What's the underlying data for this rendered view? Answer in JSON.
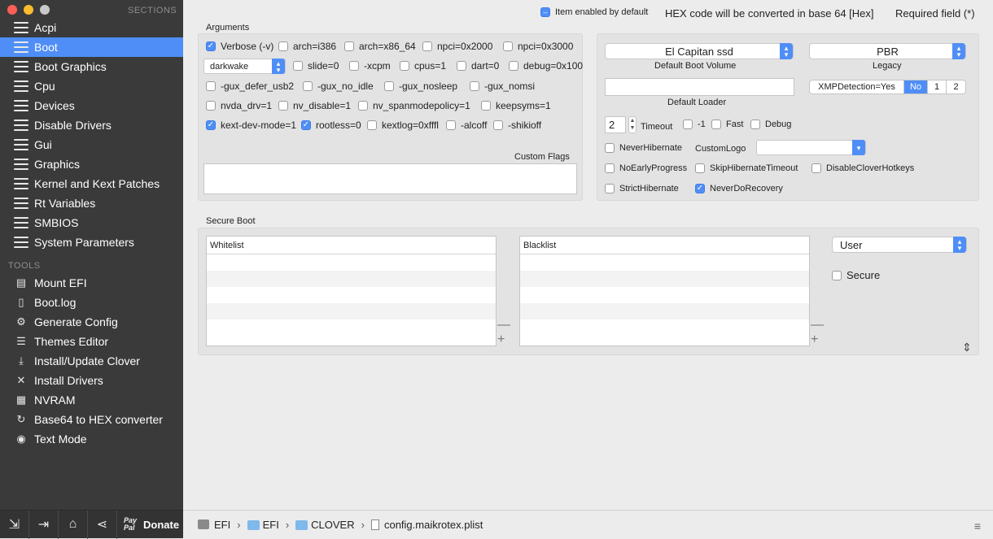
{
  "sidebar": {
    "sections_header": "SECTIONS",
    "tools_header": "TOOLS",
    "sections": [
      {
        "label": "Acpi"
      },
      {
        "label": "Boot"
      },
      {
        "label": "Boot Graphics"
      },
      {
        "label": "Cpu"
      },
      {
        "label": "Devices"
      },
      {
        "label": "Disable Drivers"
      },
      {
        "label": "Gui"
      },
      {
        "label": "Graphics"
      },
      {
        "label": "Kernel and Kext Patches"
      },
      {
        "label": "Rt Variables"
      },
      {
        "label": "SMBIOS"
      },
      {
        "label": "System Parameters"
      }
    ],
    "selected_section": "Boot",
    "tools": [
      {
        "label": "Mount EFI",
        "icon": "disk-icon"
      },
      {
        "label": "Boot.log",
        "icon": "document-icon"
      },
      {
        "label": "Generate Config",
        "icon": "gears-icon"
      },
      {
        "label": "Themes Editor",
        "icon": "hamburger-icon"
      },
      {
        "label": "Install/Update Clover",
        "icon": "download-icon"
      },
      {
        "label": "Install Drivers",
        "icon": "wrench-icon"
      },
      {
        "label": "NVRAM",
        "icon": "chip-icon"
      },
      {
        "label": "Base64 to HEX converter",
        "icon": "refresh-icon"
      },
      {
        "label": "Text Mode",
        "icon": "eye-icon"
      }
    ],
    "bottom": {
      "donate_label": "Donate",
      "paypal_text": "Pay Pal"
    }
  },
  "legend": {
    "item_enabled": "Item enabled by default",
    "hex_note": "HEX code will be converted in base 64 [Hex]",
    "required": "Required field (*)"
  },
  "arguments": {
    "title": "Arguments",
    "rows": [
      [
        {
          "label": "Verbose (-v)",
          "checked": true
        },
        {
          "label": "arch=i386",
          "checked": false
        },
        {
          "label": "arch=x86_64",
          "checked": false
        },
        {
          "label": "npci=0x2000",
          "checked": false
        },
        {
          "label": "npci=0x3000",
          "checked": false
        }
      ],
      [
        {
          "label": "slide=0",
          "checked": false
        },
        {
          "label": "-xcpm",
          "checked": false
        },
        {
          "label": "cpus=1",
          "checked": false
        },
        {
          "label": "dart=0",
          "checked": false
        },
        {
          "label": "debug=0x100",
          "checked": false
        }
      ],
      [
        {
          "label": "-gux_defer_usb2",
          "checked": false
        },
        {
          "label": "-gux_no_idle",
          "checked": false
        },
        {
          "label": "-gux_nosleep",
          "checked": false
        },
        {
          "label": "-gux_nomsi",
          "checked": false
        }
      ],
      [
        {
          "label": "nvda_drv=1",
          "checked": false
        },
        {
          "label": "nv_disable=1",
          "checked": false
        },
        {
          "label": "nv_spanmodepolicy=1",
          "checked": false
        },
        {
          "label": "keepsyms=1",
          "checked": false
        }
      ],
      [
        {
          "label": "kext-dev-mode=1",
          "checked": true
        },
        {
          "label": "rootless=0",
          "checked": true
        },
        {
          "label": "kextlog=0xfffl",
          "checked": false
        },
        {
          "label": "-alcoff",
          "checked": false
        },
        {
          "label": "-shikioff",
          "checked": false
        }
      ]
    ],
    "darkwake_value": "darkwake",
    "custom_flags_label": "Custom Flags",
    "custom_flags_value": ""
  },
  "boot_options": {
    "default_volume_value": "El Capitan ssd",
    "default_volume_label": "Default Boot Volume",
    "legacy_value": "PBR",
    "legacy_label": "Legacy",
    "default_loader_label": "Default Loader",
    "default_loader_value": "",
    "xmp_label": "XMPDetection=Yes",
    "xmp_options": [
      "No",
      "1",
      "2"
    ],
    "xmp_selected": "No",
    "timeout_value": "2",
    "timeout_label": "Timeout",
    "minus_one": "-1",
    "fast": "Fast",
    "debug": "Debug",
    "never_hibernate": "NeverHibernate",
    "custom_logo_label": "CustomLogo",
    "custom_logo_value": "",
    "no_early_progress": "NoEarlyProgress",
    "skip_hibernate_timeout": "SkipHibernateTimeout",
    "disable_clover_hotkeys": "DisableCloverHotkeys",
    "strict_hibernate": "StrictHibernate",
    "never_do_recovery": "NeverDoRecovery",
    "never_do_recovery_checked": true
  },
  "secure_boot": {
    "title": "Secure Boot",
    "whitelist_header": "Whitelist",
    "blacklist_header": "Blacklist",
    "policy_value": "User",
    "secure_label": "Secure",
    "secure_checked": false,
    "minus": "—",
    "plus": "+"
  },
  "pathbar": {
    "crumbs": [
      "EFI",
      "EFI",
      "CLOVER",
      "config.maikrotex.plist"
    ]
  },
  "colors": {
    "accent": "#4f8ef7",
    "sidebar_bg": "#3a3a3b"
  }
}
